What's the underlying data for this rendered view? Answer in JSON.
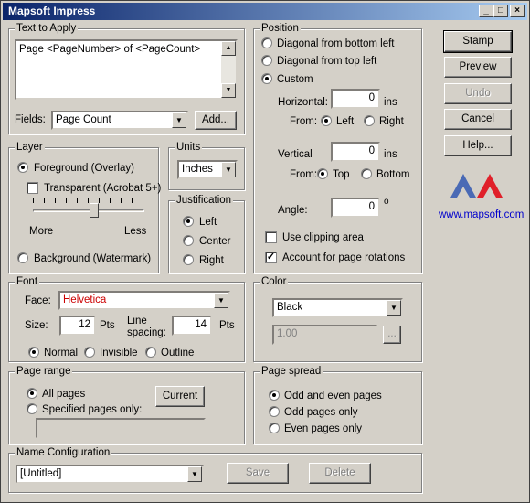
{
  "window": {
    "title": "Mapsoft Impress",
    "min": "_",
    "max": "□",
    "close": "×"
  },
  "text_group": {
    "title": "Text to Apply",
    "text": "Page <PageNumber> of <PageCount>",
    "fields_label": "Fields:",
    "fields_value": "Page Count",
    "add_button": "Add..."
  },
  "layer": {
    "title": "Layer",
    "foreground": "Foreground (Overlay)",
    "transparent": "Transparent (Acrobat 5+)",
    "more": "More",
    "less": "Less",
    "background": "Background (Watermark)",
    "slider_fraction": 0.55
  },
  "units": {
    "title": "Units",
    "value": "Inches"
  },
  "justification": {
    "title": "Justification",
    "left": "Left",
    "center": "Center",
    "right": "Right"
  },
  "position": {
    "title": "Position",
    "diag_bottom": "Diagonal from bottom left",
    "diag_top": "Diagonal from top left",
    "custom": "Custom",
    "horizontal_label": "Horizontal:",
    "horizontal_value": "0",
    "ins1": "ins",
    "from1": "From:",
    "from_left": "Left",
    "from_right": "Right",
    "vertical_label": "Vertical",
    "vertical_value": "0",
    "ins2": "ins",
    "from2": "From:",
    "from_top": "Top",
    "from_bottom": "Bottom",
    "angle_label": "Angle:",
    "angle_value": "0",
    "degree": "o",
    "clipping": "Use clipping area",
    "rotations": "Account for page rotations"
  },
  "buttons": {
    "stamp": "Stamp",
    "preview": "Preview",
    "undo": "Undo",
    "cancel": "Cancel",
    "help": "Help..."
  },
  "brand": {
    "link": "www.mapsoft.com",
    "color_blue": "#4a6ab5",
    "color_red": "#e0202a"
  },
  "font": {
    "title": "Font",
    "face_label": "Face:",
    "face_value": "Helvetica",
    "size_label": "Size:",
    "size_value": "12",
    "pts1": "Pts",
    "spacing_label1": "Line",
    "spacing_label2": "spacing:",
    "spacing_value": "14",
    "pts2": "Pts",
    "normal": "Normal",
    "invisible": "Invisible",
    "outline": "Outline"
  },
  "color": {
    "title": "Color",
    "value": "Black",
    "opacity": "1.00",
    "more": "..."
  },
  "page_range": {
    "title": "Page range",
    "all": "All pages",
    "specified": "Specified pages only:",
    "current": "Current"
  },
  "page_spread": {
    "title": "Page spread",
    "odd_even": "Odd and even pages",
    "odd": "Odd pages only",
    "even": "Even pages only"
  },
  "name_config": {
    "title": "Name Configuration",
    "value": "[Untitled]",
    "save": "Save",
    "delete": "Delete"
  }
}
